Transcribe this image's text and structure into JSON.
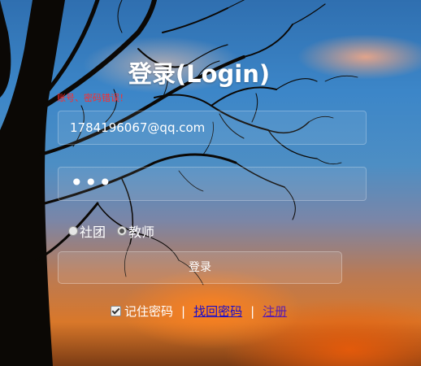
{
  "title": "登录(Login)",
  "error_message": "账号、密码错误！",
  "username_value": "1784196067@qq.com",
  "password_masked": "•••",
  "roles": [
    {
      "label": "社团",
      "checked": false
    },
    {
      "label": "教师",
      "checked": true
    }
  ],
  "login_button": "登录",
  "remember_label": "记住密码",
  "separator": "|",
  "forgot_link": "找回密码",
  "register_link": "注册",
  "colors": {
    "error": "#ff2b2b",
    "link": "#1a0dcc",
    "link_visited": "#5a1db0"
  }
}
